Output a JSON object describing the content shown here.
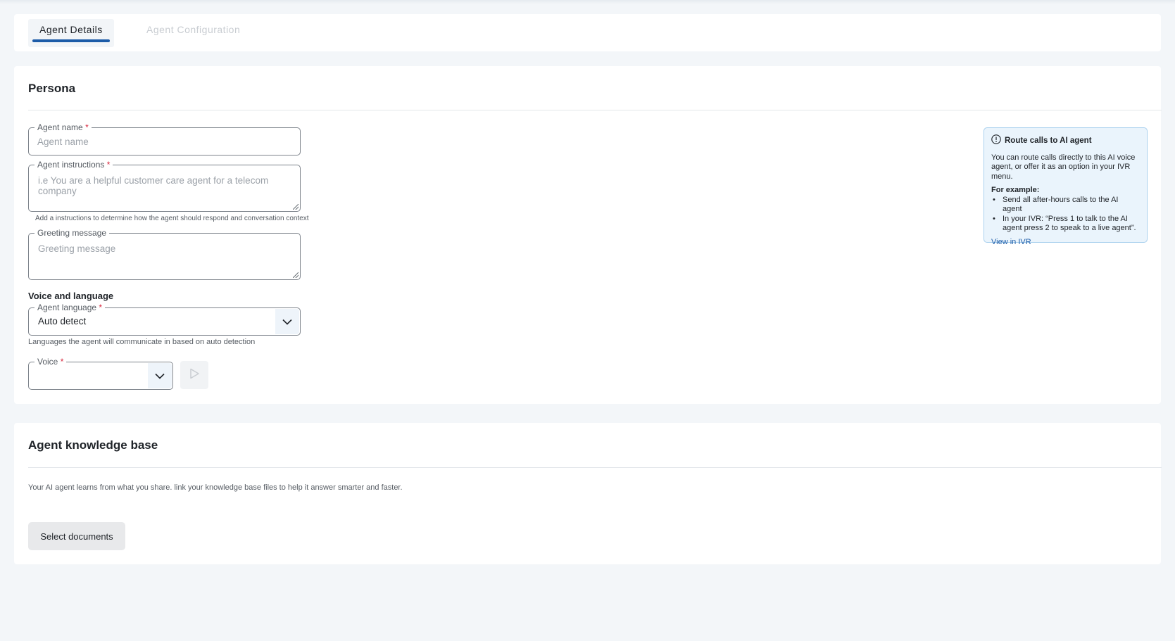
{
  "tabs": {
    "agent_details": "Agent Details",
    "agent_configuration": "Agent Configuration"
  },
  "persona": {
    "title": "Persona",
    "agent_name": {
      "label": "Agent name",
      "required": "*",
      "placeholder": "Agent name",
      "value": ""
    },
    "agent_instructions": {
      "label": "Agent instructions",
      "required": "*",
      "placeholder": "i.e You are a helpful customer care agent for a telecom company",
      "helper": "Add a instructions to determine how the agent should respond and conversation context"
    },
    "greeting_message": {
      "label": "Greeting message",
      "placeholder": "Greeting message"
    },
    "voice_and_language_title": "Voice and language",
    "agent_language": {
      "label": "Agent language",
      "required": "*",
      "value": "Auto detect",
      "helper": "Languages the agent will communicate in based on auto detection"
    },
    "voice": {
      "label": "Voice",
      "required": "*",
      "value": ""
    }
  },
  "info_box": {
    "title": "Route calls to AI agent",
    "body": "You can route calls directly to this AI voice agent, or offer it as an option in your IVR menu.",
    "example_heading": "For example:",
    "examples": [
      "Send all after-hours calls to the AI agent",
      "In your IVR: “Press 1 to talk to the AI agent press 2 to speak to a live agent”."
    ],
    "link": "View in IVR"
  },
  "knowledge_base": {
    "title": "Agent knowledge base",
    "description": "Your AI agent learns from what you share. link your knowledge base files to help it answer smarter and faster.",
    "button": "Select documents"
  },
  "colors": {
    "accent": "#1d5ca8",
    "required": "#d7263d",
    "info_bg": "#eaf4fc",
    "info_border": "#a9d0ee",
    "page_bg": "#f3f6f9"
  },
  "icons": {
    "info": "info-circle-icon",
    "chevron": "chevron-down-icon",
    "play": "play-icon"
  }
}
